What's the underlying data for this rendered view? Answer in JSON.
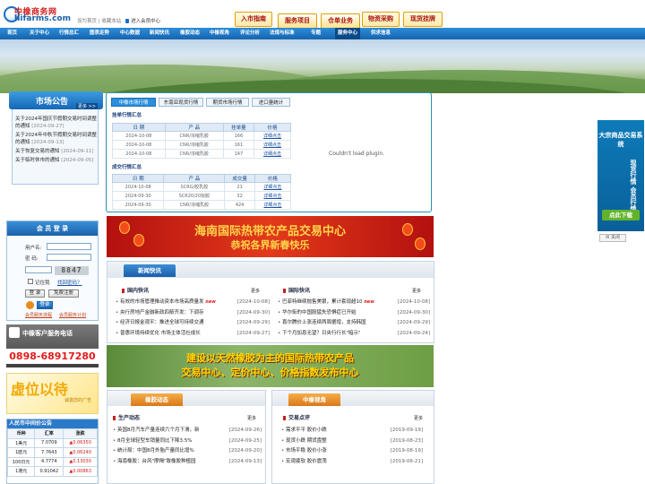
{
  "logo": {
    "cn": "中橡商务网",
    "en": "hifarms.com"
  },
  "toplinks": {
    "home": "设为首页",
    "bookmark": "收藏本站",
    "member": "进入会员中心"
  },
  "top_buttons": [
    "入市指南",
    "服务项目",
    "仓单业务",
    "物资采购",
    "现货挂牌"
  ],
  "nav": [
    "首页",
    "关于中心",
    "行情总汇",
    "图表走势",
    "中心数据",
    "新闻快讯",
    "橡胶动态",
    "中橡视角",
    "评论分析",
    "法规与标准",
    "专题",
    "服务中心",
    "供求信息"
  ],
  "notice": {
    "title": "市场公告",
    "more": "更多 >>",
    "items": [
      {
        "text": "关于2024年国庆节假期交易时间调整的通知",
        "date": "[2024-09-27]"
      },
      {
        "text": "关于2024年中秋节假期交易时间调整的通知",
        "date": "[2024-09-13]"
      },
      {
        "text": "关于恢复交易的通知",
        "date": "[2024-09-11]"
      },
      {
        "text": "关于临时休市的通知",
        "date": "[2024-09-05]"
      }
    ]
  },
  "board": {
    "tabs": [
      "中橡市场行情",
      "东南亚现货行情",
      "期货市场行情",
      "进口量统计"
    ],
    "listing_title": "挂单行情汇总",
    "trade_title": "成交行情汇总",
    "listing_cols": [
      "日 期",
      "产 品",
      "挂单量",
      "价格"
    ],
    "trade_cols": [
      "日 期",
      "产 品",
      "成交量",
      "价格"
    ],
    "listing_rows": [
      [
        "2024-10-08",
        "CNR/浓缩乳胶",
        "166",
        "详细点击"
      ],
      [
        "2024-10-08",
        "CNR/浓缩乳胶",
        "161",
        "详细点击"
      ],
      [
        "2024-10-08",
        "CNR/浓缩乳胶",
        "147",
        "详细点击"
      ]
    ],
    "trade_rows": [
      [
        "2024-10-08",
        "SCRG/胶乳胶",
        "21",
        "详细点击"
      ],
      [
        "2024-09-30",
        "SCR20/20标胶",
        "32",
        "详细点击"
      ],
      [
        "2024-09-30",
        "CNR/浓缩乳胶",
        "424",
        "详细点击"
      ]
    ],
    "plugin_msg": "Couldn't load plugin."
  },
  "banner1": {
    "line1": "海南国际热带农产品交易中心",
    "line2": "恭祝各界新春快乐"
  },
  "news": {
    "tab": "新闻快讯",
    "domestic_title": "国内快讯",
    "intl_title": "国际快讯",
    "more": "更多",
    "domestic": [
      {
        "text": "有效的市场管理推动资本市场高质量发",
        "date": "[2024-10-08]",
        "new": true
      },
      {
        "text": "央行房地产金融新政四箭齐发：下调存",
        "date": "[2024-09-30]"
      },
      {
        "text": "经济日报金观平：推进全球可持续交通",
        "date": "[2024-09-29]"
      },
      {
        "text": "普惠环境持续优化 市场主体活社成长",
        "date": "[2024-09-27]"
      }
    ],
    "intl": [
      {
        "text": "巴菲特继续抛售美银，累计套现超10",
        "date": "[2024-10-08]",
        "new": true
      },
      {
        "text": "华尔街的中国股猛失恐惧症已开始",
        "date": "[2024-09-30]"
      },
      {
        "text": "喜尔腾价上涨连续两周据增，支持韩国",
        "date": "[2024-09-29]"
      },
      {
        "text": "下个月加息无望？日央行行长\"暗示\"",
        "date": "[2024-09-24]"
      }
    ],
    "new_tag": "new"
  },
  "banner2": {
    "line1": "建设以天然橡胶为主的国际热带农产品",
    "line2": "交易中心、定价中心、价格指数发布中心"
  },
  "panel_left": {
    "tab": "橡胶动态",
    "sub": "生产动态",
    "more": "更多",
    "items": [
      {
        "text": "英国8月汽车产量连续六个月下滑，新",
        "date": "[2024-09-26]"
      },
      {
        "text": "8月全球轻型车销量同比下降3.5%",
        "date": "[2024-09-25]"
      },
      {
        "text": "统计局：中国8月外胎产量同比增%",
        "date": "[2024-09-20]"
      },
      {
        "text": "海南橡胶：台风\"摩羯\"致橡胶种植园",
        "date": "[2024-09-13]"
      }
    ]
  },
  "panel_right": {
    "tab": "中橡视角",
    "sub": "交易点评",
    "more": "更多",
    "items": [
      {
        "text": "需求平平 胶价小跌",
        "date": "[2019-09-19]"
      },
      {
        "text": "现货小跌 期货盘整",
        "date": "[2019-08-23]"
      },
      {
        "text": "市场平稳 胶价小涨",
        "date": "[2019-08-19]"
      },
      {
        "text": "宏观疲软 胶价震荡",
        "date": "[2019-06-21]"
      }
    ]
  },
  "login": {
    "title": "会 员 登 录",
    "user_label": "用户名:",
    "pass_label": "密  码:",
    "captcha": "8847",
    "remember": "记住我",
    "forgot": "找回密码？",
    "login_btn": "登 录",
    "register_btn": "免费注册",
    "enter_btn": "登录",
    "link1": "会员服务流程",
    "link2": "会员服务计划"
  },
  "service": {
    "title": "中橡客户服务电话",
    "phone": "0898-68917280"
  },
  "adleft": {
    "title": "虚位以待",
    "sub": "诚邀您的广告"
  },
  "rmb": {
    "title": "人民币中间价公告",
    "cols": [
      "币种",
      "汇率",
      "涨跌"
    ],
    "rows": [
      [
        "1美元",
        "7.0709",
        "0.06350"
      ],
      [
        "1欧元",
        "7.7643",
        "0.06240"
      ],
      [
        "100日元",
        "4.7774",
        "0.13030"
      ],
      [
        "1港元",
        "0.91042",
        "0.00863"
      ]
    ]
  },
  "rightad": {
    "title": "大宗商品交易系统",
    "vertical": "现货行情 会员行情",
    "button": "点此下载",
    "close": "关闭"
  },
  "colors": {
    "nav": "#1564ae",
    "accent_red": "#c62020",
    "panel_orange": "#e6932a"
  }
}
